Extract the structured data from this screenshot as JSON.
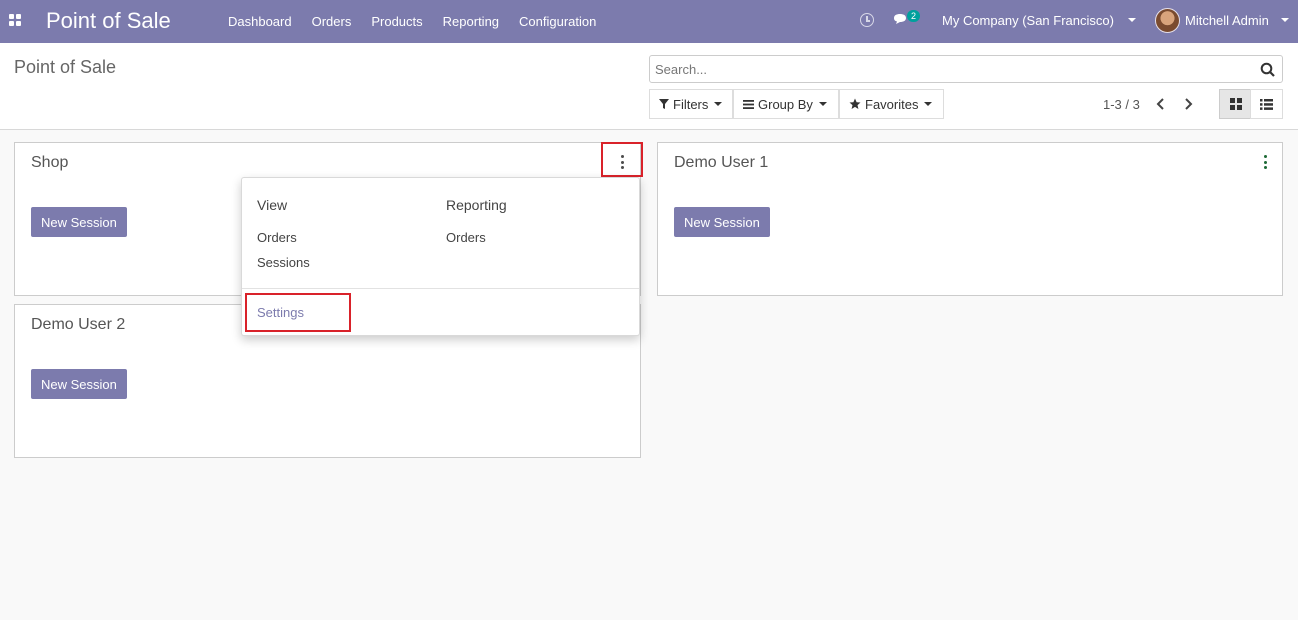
{
  "navbar": {
    "app_title": "Point of Sale",
    "menu": [
      "Dashboard",
      "Orders",
      "Products",
      "Reporting",
      "Configuration"
    ],
    "messages_count": "2",
    "company": "My Company (San Francisco)",
    "user": "Mitchell Admin"
  },
  "control_panel": {
    "breadcrumb": "Point of Sale",
    "search_placeholder": "Search...",
    "filters_label": "Filters",
    "group_by_label": "Group By",
    "favorites_label": "Favorites",
    "pager": "1-3 / 3"
  },
  "cards": [
    {
      "title": "Shop",
      "button": "New Session"
    },
    {
      "title": "Demo User 1",
      "button": "New Session"
    },
    {
      "title": "Demo User 2",
      "button": "New Session"
    }
  ],
  "dropdown": {
    "view_heading": "View",
    "reporting_heading": "Reporting",
    "view_items": [
      "Orders",
      "Sessions"
    ],
    "reporting_items": [
      "Orders"
    ],
    "settings": "Settings"
  },
  "colors": {
    "navbar": "#7c7bad",
    "primary_button": "#7c7bad",
    "highlight": "#d9222a",
    "badge": "#00a09d"
  }
}
